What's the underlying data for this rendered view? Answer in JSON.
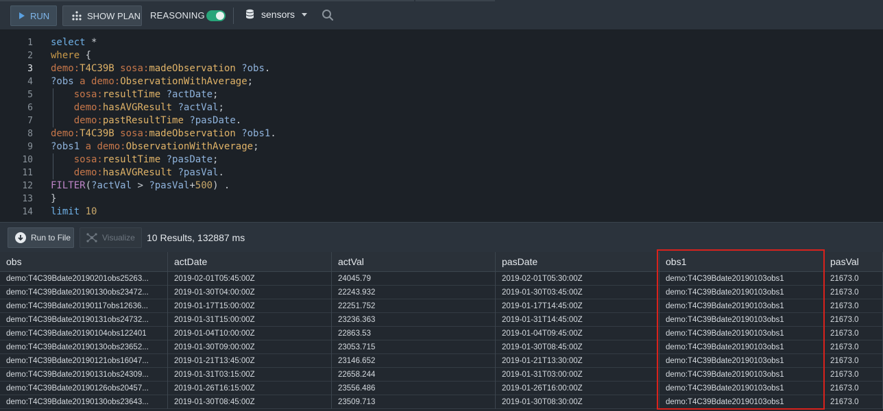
{
  "toolbar": {
    "run_label": "RUN",
    "show_plan_label": "SHOW PLAN",
    "reasoning_label": "REASONING",
    "reasoning_on": true,
    "database": "sensors",
    "accent": "#28a57a"
  },
  "editor": {
    "current_line": 3,
    "lines": [
      {
        "n": "1",
        "tokens": [
          [
            "kw",
            "select"
          ],
          [
            "pun",
            " *"
          ]
        ]
      },
      {
        "n": "2",
        "tokens": [
          [
            "kw2",
            "where"
          ],
          [
            "pun",
            " {"
          ]
        ]
      },
      {
        "n": "3",
        "tokens": [
          [
            "pfx",
            "demo:"
          ],
          [
            "loc",
            "T4C39B"
          ],
          [
            "pun",
            " "
          ],
          [
            "pfx",
            "sosa:"
          ],
          [
            "loc",
            "madeObservation"
          ],
          [
            "pun",
            " "
          ],
          [
            "var",
            "?obs"
          ],
          [
            "pun",
            "."
          ]
        ]
      },
      {
        "n": "4",
        "tokens": [
          [
            "var",
            "?obs"
          ],
          [
            "pun",
            " "
          ],
          [
            "pfx",
            "a"
          ],
          [
            "pun",
            " "
          ],
          [
            "pfx",
            "demo:"
          ],
          [
            "loc",
            "ObservationWithAverage"
          ],
          [
            "pun",
            ";"
          ]
        ]
      },
      {
        "n": "5",
        "tokens": [
          [
            "pun",
            "    "
          ],
          [
            "pfx",
            "sosa:"
          ],
          [
            "loc",
            "resultTime"
          ],
          [
            "pun",
            " "
          ],
          [
            "var",
            "?actDate"
          ],
          [
            "pun",
            ";"
          ]
        ]
      },
      {
        "n": "6",
        "tokens": [
          [
            "pun",
            "    "
          ],
          [
            "pfx",
            "demo:"
          ],
          [
            "loc",
            "hasAVGResult"
          ],
          [
            "pun",
            " "
          ],
          [
            "var",
            "?actVal"
          ],
          [
            "pun",
            ";"
          ]
        ]
      },
      {
        "n": "7",
        "tokens": [
          [
            "pun",
            "    "
          ],
          [
            "pfx",
            "demo:"
          ],
          [
            "loc",
            "pastResultTime"
          ],
          [
            "pun",
            " "
          ],
          [
            "var",
            "?pasDate"
          ],
          [
            "pun",
            "."
          ]
        ]
      },
      {
        "n": "8",
        "tokens": [
          [
            "pfx",
            "demo:"
          ],
          [
            "loc",
            "T4C39B"
          ],
          [
            "pun",
            " "
          ],
          [
            "pfx",
            "sosa:"
          ],
          [
            "loc",
            "madeObservation"
          ],
          [
            "pun",
            " "
          ],
          [
            "var",
            "?obs1"
          ],
          [
            "pun",
            "."
          ]
        ]
      },
      {
        "n": "9",
        "tokens": [
          [
            "var",
            "?obs1"
          ],
          [
            "pun",
            " "
          ],
          [
            "pfx",
            "a"
          ],
          [
            "pun",
            " "
          ],
          [
            "pfx",
            "demo:"
          ],
          [
            "loc",
            "ObservationWithAverage"
          ],
          [
            "pun",
            ";"
          ]
        ]
      },
      {
        "n": "10",
        "tokens": [
          [
            "pun",
            "    "
          ],
          [
            "pfx",
            "sosa:"
          ],
          [
            "loc",
            "resultTime"
          ],
          [
            "pun",
            " "
          ],
          [
            "var",
            "?pasDate"
          ],
          [
            "pun",
            ";"
          ]
        ]
      },
      {
        "n": "11",
        "tokens": [
          [
            "pun",
            "    "
          ],
          [
            "pfx",
            "demo:"
          ],
          [
            "loc",
            "hasAVGResult"
          ],
          [
            "pun",
            " "
          ],
          [
            "var",
            "?pasVal"
          ],
          [
            "pun",
            "."
          ]
        ]
      },
      {
        "n": "12",
        "tokens": [
          [
            "fn",
            "FILTER"
          ],
          [
            "pun",
            "("
          ],
          [
            "var",
            "?actVal"
          ],
          [
            "pun",
            " > "
          ],
          [
            "var",
            "?pasVal"
          ],
          [
            "pun",
            "+"
          ],
          [
            "num",
            "500"
          ],
          [
            "pun",
            ") ."
          ]
        ]
      },
      {
        "n": "13",
        "tokens": [
          [
            "pun",
            "}"
          ]
        ]
      },
      {
        "n": "14",
        "tokens": [
          [
            "kw",
            "limit"
          ],
          [
            "pun",
            " "
          ],
          [
            "num",
            "10"
          ]
        ]
      }
    ]
  },
  "results_bar": {
    "run_to_file_label": "Run to File",
    "visualize_label": "Visualize",
    "summary": "10 Results,  132887 ms"
  },
  "table": {
    "columns": [
      "obs",
      "actDate",
      "actVal",
      "pasDate",
      "obs1",
      "pasVal"
    ],
    "rows": [
      [
        "demo:T4C39Bdate20190201obs25263...",
        "2019-02-01T05:45:00Z",
        "24045.79",
        "2019-02-01T05:30:00Z",
        "demo:T4C39Bdate20190103obs1",
        "21673.0"
      ],
      [
        "demo:T4C39Bdate20190130obs23472...",
        "2019-01-30T04:00:00Z",
        "22243.932",
        "2019-01-30T03:45:00Z",
        "demo:T4C39Bdate20190103obs1",
        "21673.0"
      ],
      [
        "demo:T4C39Bdate20190117obs12636...",
        "2019-01-17T15:00:00Z",
        "22251.752",
        "2019-01-17T14:45:00Z",
        "demo:T4C39Bdate20190103obs1",
        "21673.0"
      ],
      [
        "demo:T4C39Bdate20190131obs24732...",
        "2019-01-31T15:00:00Z",
        "23236.363",
        "2019-01-31T14:45:00Z",
        "demo:T4C39Bdate20190103obs1",
        "21673.0"
      ],
      [
        "demo:T4C39Bdate20190104obs122401",
        "2019-01-04T10:00:00Z",
        "22863.53",
        "2019-01-04T09:45:00Z",
        "demo:T4C39Bdate20190103obs1",
        "21673.0"
      ],
      [
        "demo:T4C39Bdate20190130obs23652...",
        "2019-01-30T09:00:00Z",
        "23053.715",
        "2019-01-30T08:45:00Z",
        "demo:T4C39Bdate20190103obs1",
        "21673.0"
      ],
      [
        "demo:T4C39Bdate20190121obs16047...",
        "2019-01-21T13:45:00Z",
        "23146.652",
        "2019-01-21T13:30:00Z",
        "demo:T4C39Bdate20190103obs1",
        "21673.0"
      ],
      [
        "demo:T4C39Bdate20190131obs24309...",
        "2019-01-31T03:15:00Z",
        "22658.244",
        "2019-01-31T03:00:00Z",
        "demo:T4C39Bdate20190103obs1",
        "21673.0"
      ],
      [
        "demo:T4C39Bdate20190126obs20457...",
        "2019-01-26T16:15:00Z",
        "23556.486",
        "2019-01-26T16:00:00Z",
        "demo:T4C39Bdate20190103obs1",
        "21673.0"
      ],
      [
        "demo:T4C39Bdate20190130obs23643...",
        "2019-01-30T08:45:00Z",
        "23509.713",
        "2019-01-30T08:30:00Z",
        "demo:T4C39Bdate20190103obs1",
        "21673.0"
      ]
    ],
    "highlighted_column": "obs1",
    "highlight_color": "#d9221c"
  }
}
